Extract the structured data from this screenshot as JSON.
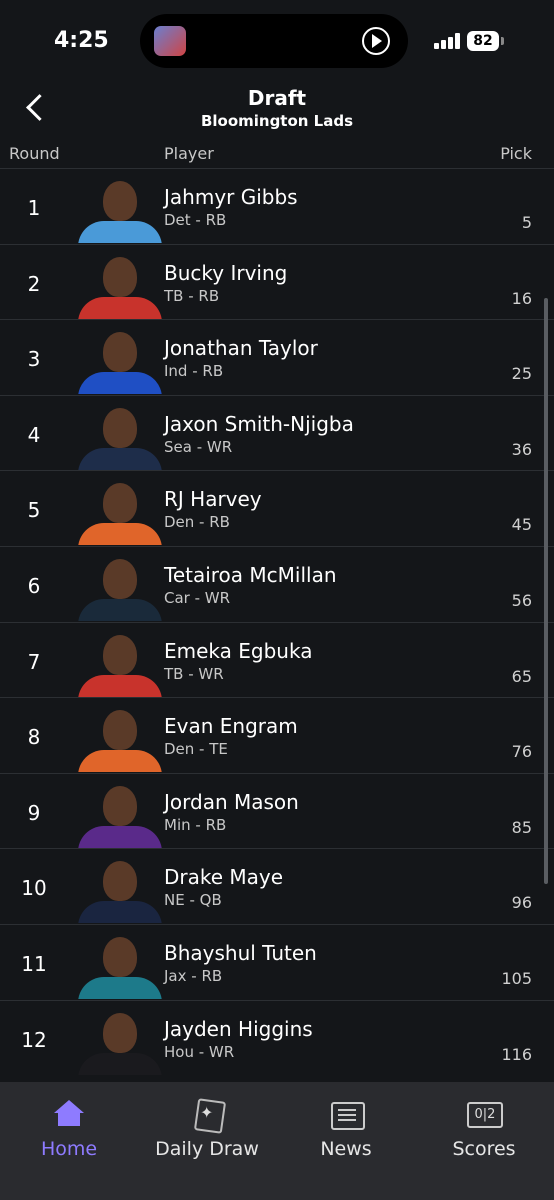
{
  "status_bar": {
    "time": "4:25",
    "battery": "82"
  },
  "header": {
    "title": "Draft",
    "subtitle": "Bloomington Lads"
  },
  "columns": {
    "round": "Round",
    "player": "Player",
    "pick": "Pick"
  },
  "picks": [
    {
      "round": "1",
      "name": "Jahmyr Gibbs",
      "team": "Det - RB",
      "pick": "5",
      "jersey": "#4a9ad8"
    },
    {
      "round": "2",
      "name": "Bucky Irving",
      "team": "TB - RB",
      "pick": "16",
      "jersey": "#c8332c"
    },
    {
      "round": "3",
      "name": "Jonathan Taylor",
      "team": "Ind - RB",
      "pick": "25",
      "jersey": "#1f4fc4"
    },
    {
      "round": "4",
      "name": "Jaxon Smith-Njigba",
      "team": "Sea - WR",
      "pick": "36",
      "jersey": "#1e2d4a"
    },
    {
      "round": "5",
      "name": "RJ Harvey",
      "team": "Den - RB",
      "pick": "45",
      "jersey": "#e0652a"
    },
    {
      "round": "6",
      "name": "Tetairoa McMillan",
      "team": "Car - WR",
      "pick": "56",
      "jersey": "#1a2a3a"
    },
    {
      "round": "7",
      "name": "Emeka Egbuka",
      "team": "TB - WR",
      "pick": "65",
      "jersey": "#c8332c"
    },
    {
      "round": "8",
      "name": "Evan Engram",
      "team": "Den - TE",
      "pick": "76",
      "jersey": "#e0652a"
    },
    {
      "round": "9",
      "name": "Jordan Mason",
      "team": "Min - RB",
      "pick": "85",
      "jersey": "#5a2a8a"
    },
    {
      "round": "10",
      "name": "Drake Maye",
      "team": "NE - QB",
      "pick": "96",
      "jersey": "#1a2540"
    },
    {
      "round": "11",
      "name": "Bhayshul Tuten",
      "team": "Jax - RB",
      "pick": "105",
      "jersey": "#1d7a8a"
    },
    {
      "round": "12",
      "name": "Jayden Higgins",
      "team": "Hou - WR",
      "pick": "116",
      "jersey": "#1a1a1e"
    }
  ],
  "tabs": [
    {
      "label": "Home",
      "icon": "home-icon"
    },
    {
      "label": "Daily Draw",
      "icon": "cards-icon"
    },
    {
      "label": "News",
      "icon": "newspaper-icon"
    },
    {
      "label": "Scores",
      "icon": "scoreboard-icon"
    }
  ],
  "colors": {
    "accent": "#8e7bff",
    "background": "#141619",
    "tabbar": "#2a2b2f"
  }
}
